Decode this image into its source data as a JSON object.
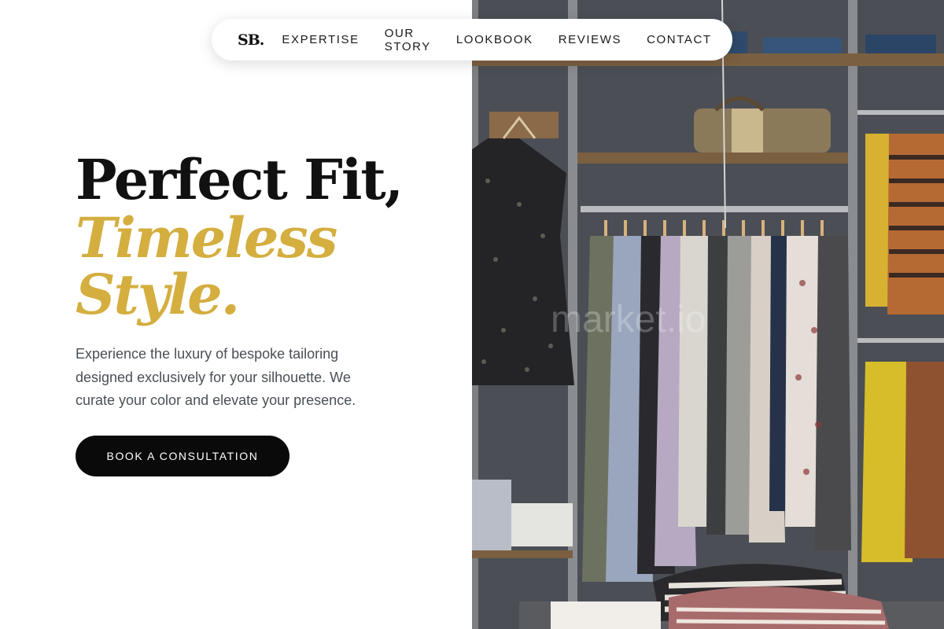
{
  "nav": {
    "logo": "SB.",
    "links": [
      {
        "label": "EXPERTISE"
      },
      {
        "label": "OUR STORY"
      },
      {
        "label": "LOOKBOOK"
      },
      {
        "label": "REVIEWS"
      },
      {
        "label": "CONTACT"
      }
    ]
  },
  "hero": {
    "title_line1": "Perfect Fit,",
    "title_line2": "Timeless",
    "title_line3": "Style.",
    "description": "Experience the luxury of bespoke tailoring designed exclusively for your silhouette. We curate your color and elevate your presence.",
    "cta_label": "BOOK A CONSULTATION",
    "image": {
      "icon": "clothing-rack-photo",
      "watermark": "market.io"
    }
  },
  "colors": {
    "accent_gold": "#d4ae3f",
    "text_dark": "#111111",
    "text_muted": "#4a4f57",
    "button_bg": "#0a0a0a",
    "page_bg": "#ffffff"
  }
}
